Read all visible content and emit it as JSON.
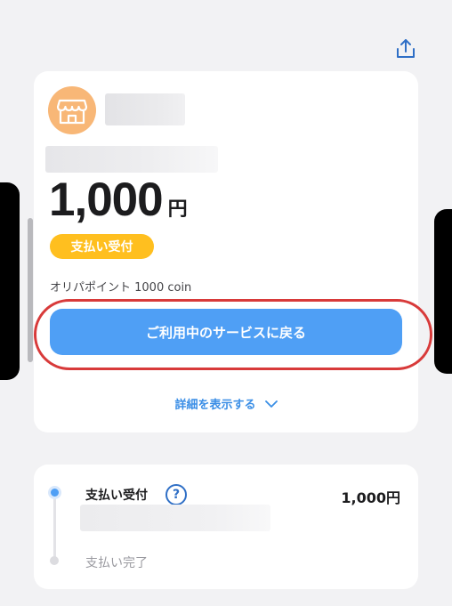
{
  "amount": {
    "value": "1,000",
    "unit": "円"
  },
  "status_badge": "支払い受付",
  "points_text": "オリパポイント 1000 coin",
  "return_button": "ご利用中のサービスに戻る",
  "details_toggle": "詳細を表示する",
  "timeline": {
    "step1": {
      "label": "支払い受付",
      "amount": "1,000円",
      "help": "?"
    },
    "step2": {
      "label": "支払い完了"
    }
  },
  "colors": {
    "accent": "#4f9ff5",
    "badge": "#ffbf1f",
    "avatar": "#f8b777",
    "highlight": "#d83a3a",
    "link": "#3a8ee6"
  },
  "icons": [
    "share-icon",
    "store-icon",
    "chevron-down-icon",
    "help-icon"
  ]
}
